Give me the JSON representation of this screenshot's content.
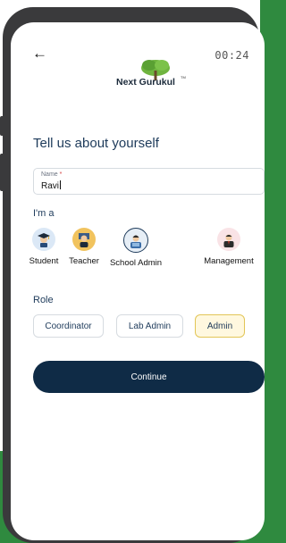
{
  "status_bar": {
    "time": "00:24"
  },
  "nav": {
    "back_icon": "arrow-left-icon"
  },
  "brand": {
    "logo_text": "Next Gurukul",
    "trademark": "TM"
  },
  "page": {
    "heading": "Tell us about yourself"
  },
  "name_field": {
    "label": "Name",
    "required_mark": "*",
    "value": "Ravi"
  },
  "user_type": {
    "title": "I'm a",
    "options": [
      {
        "label": "Student",
        "icon": "student-graduate-icon",
        "bg": "#dbe8f6"
      },
      {
        "label": "Teacher",
        "icon": "teacher-icon",
        "bg": "#f1c35e"
      },
      {
        "label": "School Admin",
        "icon": "school-admin-icon",
        "bg": "#e6eef6",
        "selected": true
      },
      {
        "label": "Management",
        "icon": "management-icon",
        "bg": "#f9e3e6"
      }
    ]
  },
  "role": {
    "title": "Role",
    "options": [
      {
        "label": "Coordinator"
      },
      {
        "label": "Lab Admin"
      },
      {
        "label": "Admin",
        "selected": true
      }
    ]
  },
  "cta": {
    "continue_label": "Continue"
  },
  "colors": {
    "primary": "#0f2b46",
    "heading": "#1d3a5a",
    "selected_chip": "#fff8df",
    "brand_green": "#2f8a3f"
  }
}
